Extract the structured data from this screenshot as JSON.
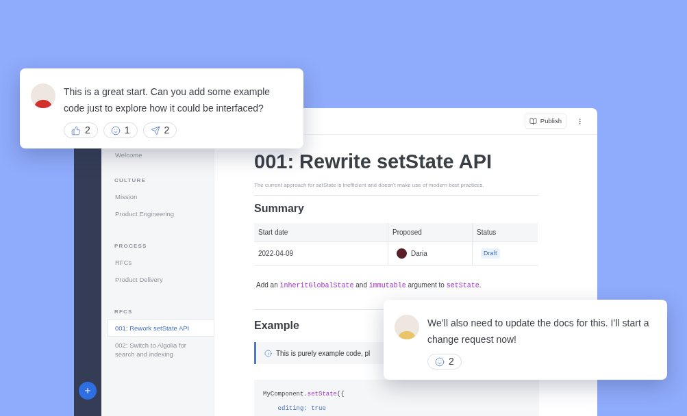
{
  "sidebar": {
    "sections": [
      {
        "items": [
          {
            "label": "Welcome",
            "selected": false
          }
        ]
      },
      {
        "heading": "CULTURE",
        "items": [
          {
            "label": "Mission",
            "selected": false
          },
          {
            "label": "Product Engineering",
            "selected": false
          }
        ]
      },
      {
        "heading": "PROCESS",
        "items": [
          {
            "label": "RFCs",
            "selected": false
          },
          {
            "label": "Product Delivery",
            "selected": false
          }
        ]
      },
      {
        "heading": "RFCS",
        "items": [
          {
            "label": "001: Rework setState API",
            "selected": true
          },
          {
            "label": "002: Switch to Algolia for search and indexing",
            "selected": false
          }
        ]
      }
    ]
  },
  "toolbar": {
    "publish": "Publish"
  },
  "document": {
    "title": "001: Rewrite setState API",
    "subtitle": "The current approach for setState is inefficient and doesn't make use of modern best practices.",
    "summary_heading": "Summary",
    "table": {
      "columns": [
        "Start date",
        "Proposed",
        "Status"
      ],
      "rows": [
        {
          "start_date": "2022-04-09",
          "proposed": "Daria",
          "status": "Draft"
        }
      ]
    },
    "sentence": [
      {
        "kind": "text",
        "text": "Add an "
      },
      {
        "kind": "code",
        "text": "inheritGlobalState"
      },
      {
        "kind": "text",
        "text": " and "
      },
      {
        "kind": "code",
        "text": "immutable"
      },
      {
        "kind": "text",
        "text": " argument to "
      },
      {
        "kind": "code",
        "text": "setState"
      },
      {
        "kind": "text",
        "text": "."
      }
    ],
    "example_heading": "Example",
    "callout": "This is purely example code, pl",
    "code_lines": [
      [
        {
          "kind": "plain",
          "text": "MyComponent."
        },
        {
          "kind": "method",
          "text": "setState"
        },
        {
          "kind": "plain",
          "text": "({"
        }
      ],
      [
        {
          "kind": "key",
          "text": "    editing: true"
        }
      ]
    ]
  },
  "comments": [
    {
      "text": "This is a great start. Can you add some example code just to explore how it could be interfaced?",
      "reactions": [
        {
          "kind": "thumbs",
          "count": "2"
        },
        {
          "kind": "smile",
          "count": "1"
        },
        {
          "kind": "send",
          "count": "2"
        }
      ]
    },
    {
      "text": "We’ll also need to update the docs for this. I’ll start a change request now!",
      "reactions": [
        {
          "kind": "smile",
          "count": "2"
        }
      ]
    }
  ]
}
